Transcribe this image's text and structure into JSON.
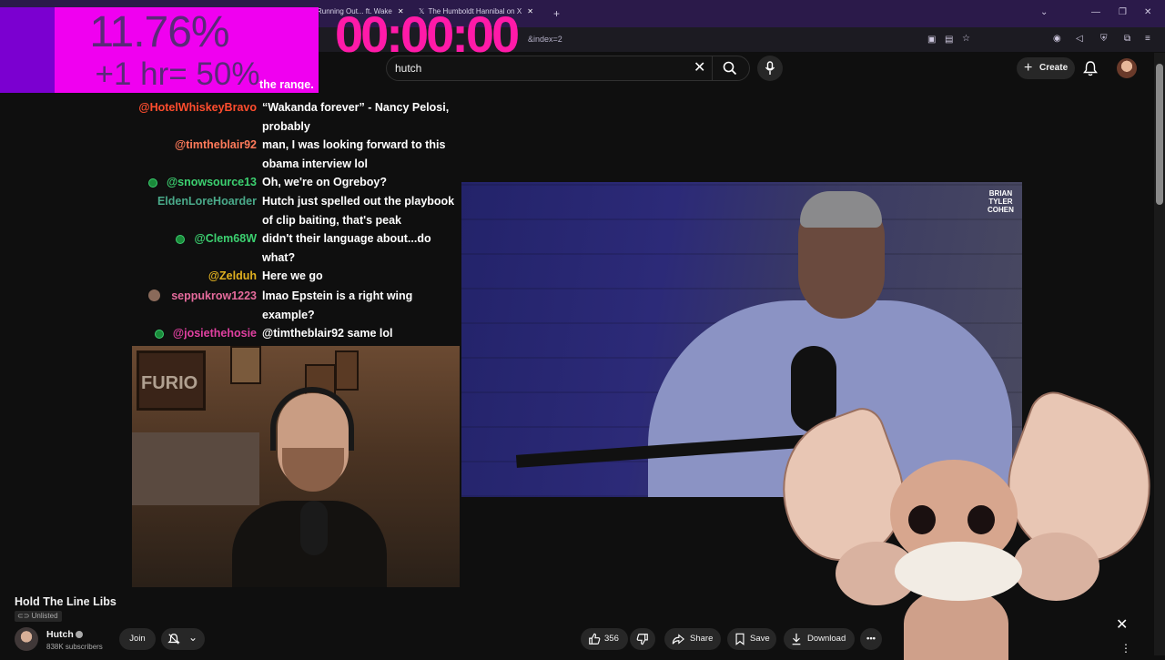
{
  "browser": {
    "tabs": [
      {
        "label": "Running Out... ft. Wake"
      },
      {
        "label": "The Humboldt Hannibal on X"
      }
    ],
    "url_fragment": "&index=2"
  },
  "overlay": {
    "percent": "11.76%",
    "hour_note": "+1 hr= 50%",
    "timer": "00:00:00"
  },
  "youtube": {
    "search_value": "hutch",
    "create_label": "Create"
  },
  "chat": {
    "top_partial": "the range.",
    "messages": [
      {
        "user": "@HotelWhiskeyBravo",
        "color": "#ff4d2e",
        "badge": false,
        "lines": [
          "“Wakanda forever” - Nancy Pelosi,",
          "probably"
        ]
      },
      {
        "user": "@timtheblair92",
        "color": "#ff7a5a",
        "badge": false,
        "lines": [
          "man, I was looking forward to this",
          "obama interview lol"
        ]
      },
      {
        "user": "@snowsource13",
        "color": "#3cd070",
        "badge": true,
        "lines": [
          "Oh, we're on Ogreboy?"
        ]
      },
      {
        "user": "EldenLoreHoarder",
        "color": "#4aaa8a",
        "badge": false,
        "lines": [
          "Hutch just spelled out the playbook",
          "of clip baiting, that's peak"
        ]
      },
      {
        "user": "@Clem68W",
        "color": "#3cd070",
        "badge": true,
        "lines": [
          "didn't their language about...do",
          "what?"
        ]
      },
      {
        "user": "@Zelduh",
        "color": "#e0b020",
        "badge": false,
        "lines": [
          "Here we go"
        ]
      },
      {
        "user": "seppukrow1223",
        "color": "#e56b9c",
        "badge": false,
        "lines": [
          "lmao Epstein is a right wing",
          "example?"
        ]
      },
      {
        "user": "@josiethehosie",
        "color": "#e040a0",
        "badge": true,
        "lines": [
          "@timtheblair92 same lol"
        ]
      }
    ]
  },
  "video": {
    "logo_lines": [
      "BRIAN",
      "TYLER",
      "COHEN"
    ]
  },
  "webcam": {
    "poster_text": "FURIO"
  },
  "watch": {
    "title": "Hold The Line Libs",
    "visibility": "Unlisted",
    "channel_name": "Hutch",
    "subscribers": "838K subscribers",
    "join_label": "Join",
    "likes": "356",
    "share_label": "Share",
    "save_label": "Save",
    "download_label": "Download"
  }
}
